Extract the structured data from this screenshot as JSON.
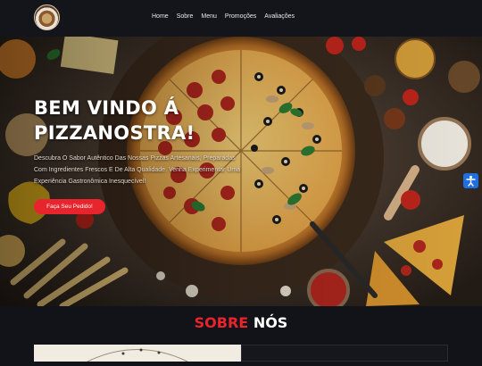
{
  "nav": {
    "links": [
      "Home",
      "Sobre",
      "Menu",
      "Promoções",
      "Avaliações"
    ]
  },
  "hero": {
    "title_line1": "BEM VINDO Á",
    "title_line2": "PIZZANOSTRA!",
    "description": "Descubra O Sabor Autêntico Das Nossas Pizzas Artesanais, Preparadas Com Ingredientes Frescos E De Alta Qualidade. Venha Experimentar Uma Experiência Gastronômica Inesquecível!",
    "cta_label": "Faça Seu Pedido!"
  },
  "about": {
    "title_accent": "SOBRE",
    "title_rest": "NÓS"
  },
  "colors": {
    "accent": "#e8242c",
    "navbar_bg": "#14151b",
    "page_bg": "#121318",
    "a11y_blue": "#1f6fe0"
  },
  "icons": {
    "logo": "pizzeria-logo",
    "a11y": "accessibility-icon"
  }
}
